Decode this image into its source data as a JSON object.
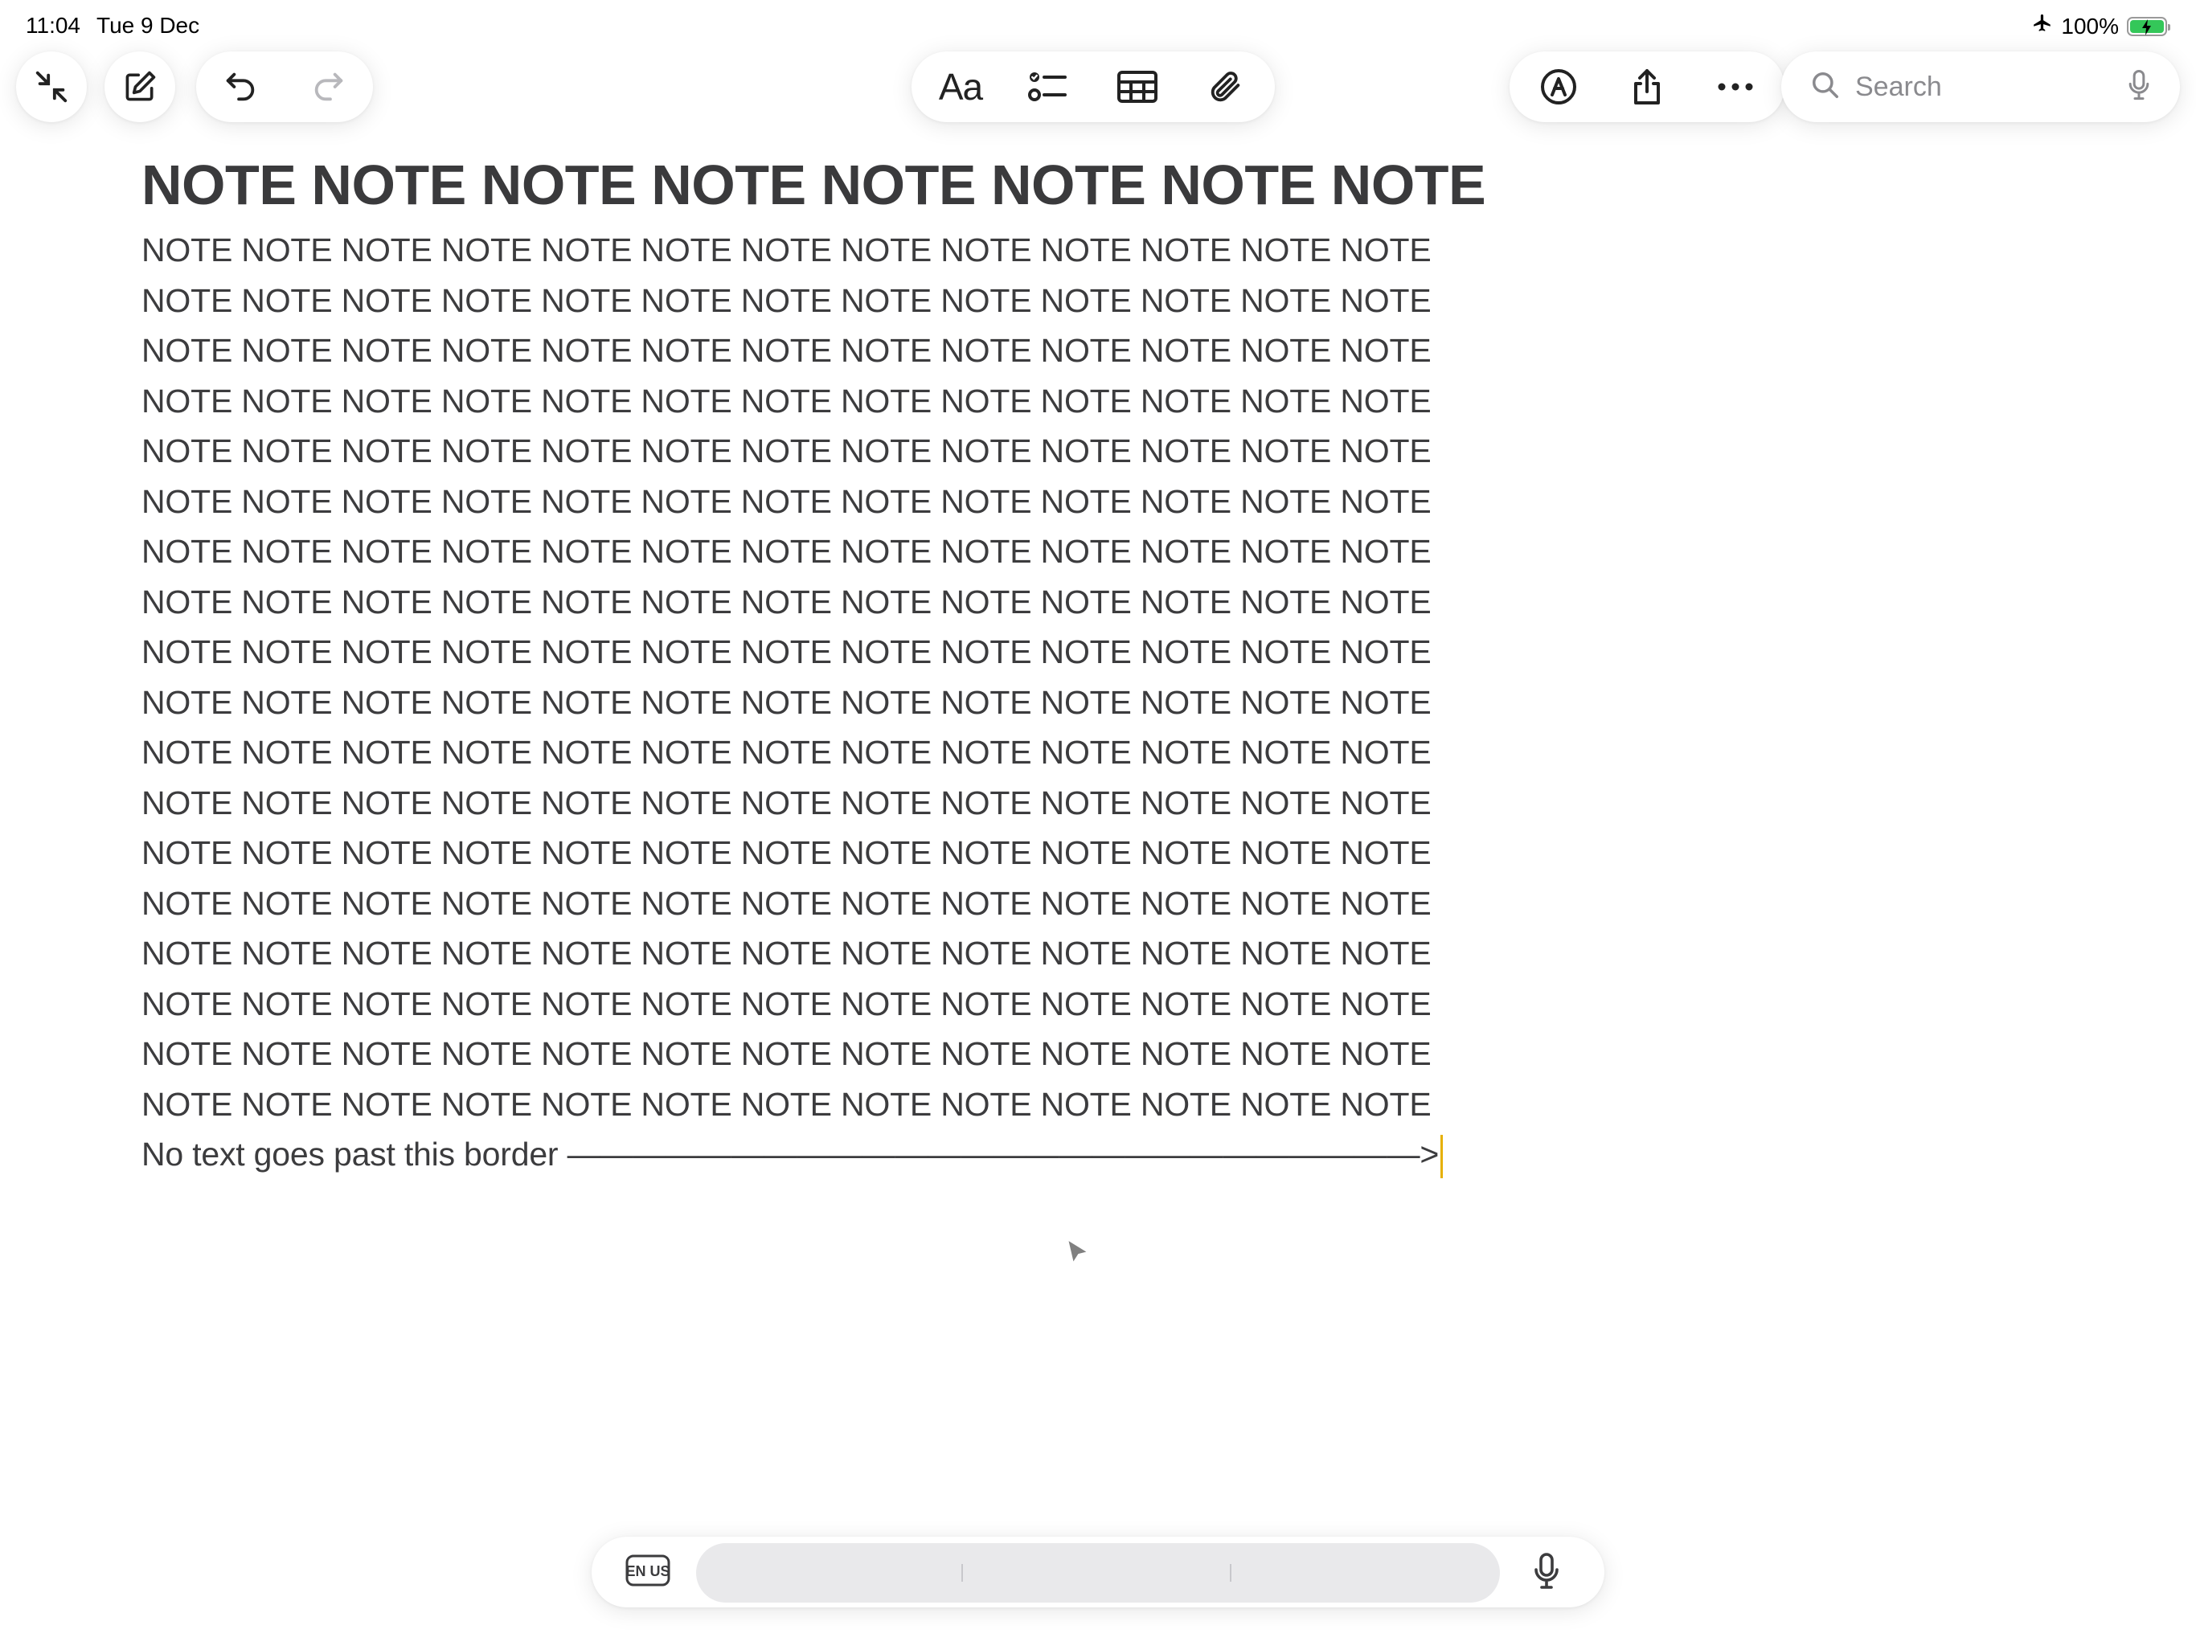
{
  "status_bar": {
    "time": "11:04",
    "date": "Tue 9 Dec",
    "battery_percent": "100%",
    "airplane_icon": "airplane-icon",
    "battery_icon": "battery-charging-icon"
  },
  "toolbar": {
    "left": [
      "collapse-icon",
      "compose-icon",
      "undo-icon",
      "redo-icon"
    ],
    "center": [
      "format-text-icon",
      "checklist-icon",
      "table-icon",
      "attachment-icon"
    ],
    "format_label": "Aa",
    "right": [
      "markup-icon",
      "share-icon",
      "more-icon"
    ]
  },
  "search": {
    "placeholder": "Search",
    "icon": "search-icon",
    "mic_icon": "microphone-icon"
  },
  "note": {
    "title": "NOTE NOTE NOTE NOTE NOTE NOTE NOTE NOTE",
    "lines": [
      "NOTE NOTE NOTE NOTE NOTE NOTE NOTE NOTE NOTE NOTE NOTE NOTE NOTE",
      "NOTE NOTE NOTE NOTE NOTE NOTE NOTE NOTE NOTE NOTE NOTE NOTE NOTE",
      "NOTE NOTE NOTE NOTE NOTE NOTE NOTE NOTE NOTE NOTE NOTE NOTE NOTE",
      "NOTE NOTE NOTE NOTE NOTE NOTE NOTE NOTE NOTE NOTE NOTE NOTE NOTE",
      "NOTE NOTE NOTE NOTE NOTE NOTE NOTE NOTE NOTE NOTE NOTE NOTE NOTE",
      "NOTE NOTE NOTE NOTE NOTE NOTE NOTE NOTE NOTE NOTE NOTE NOTE NOTE",
      "NOTE NOTE NOTE NOTE NOTE NOTE NOTE NOTE NOTE NOTE NOTE NOTE NOTE",
      "NOTE NOTE NOTE NOTE NOTE NOTE NOTE NOTE NOTE NOTE NOTE NOTE NOTE",
      "NOTE NOTE NOTE NOTE NOTE NOTE NOTE NOTE NOTE NOTE NOTE NOTE NOTE",
      "NOTE NOTE NOTE NOTE NOTE NOTE NOTE NOTE NOTE NOTE NOTE NOTE NOTE",
      "NOTE NOTE NOTE NOTE NOTE NOTE NOTE NOTE NOTE NOTE NOTE NOTE NOTE",
      "NOTE NOTE NOTE NOTE NOTE NOTE NOTE NOTE NOTE NOTE NOTE NOTE NOTE",
      "NOTE NOTE NOTE NOTE NOTE NOTE NOTE NOTE NOTE NOTE NOTE NOTE NOTE",
      "NOTE NOTE NOTE NOTE NOTE NOTE NOTE NOTE NOTE NOTE NOTE NOTE NOTE",
      "NOTE NOTE NOTE NOTE NOTE NOTE NOTE NOTE NOTE NOTE NOTE NOTE NOTE",
      "NOTE NOTE NOTE NOTE NOTE NOTE NOTE NOTE NOTE NOTE NOTE NOTE NOTE",
      "NOTE NOTE NOTE NOTE NOTE NOTE NOTE NOTE NOTE NOTE NOTE NOTE NOTE",
      "NOTE NOTE NOTE NOTE NOTE NOTE NOTE NOTE NOTE NOTE NOTE NOTE NOTE"
    ],
    "last_line": "No text goes past this border ——————————————————————————>"
  },
  "keyboard_bar": {
    "language_label": "EN US",
    "mic_icon": "microphone-icon"
  },
  "colors": {
    "accent_caret": "#e6b000",
    "text": "#3c3c3e",
    "battery": "#34c759"
  }
}
